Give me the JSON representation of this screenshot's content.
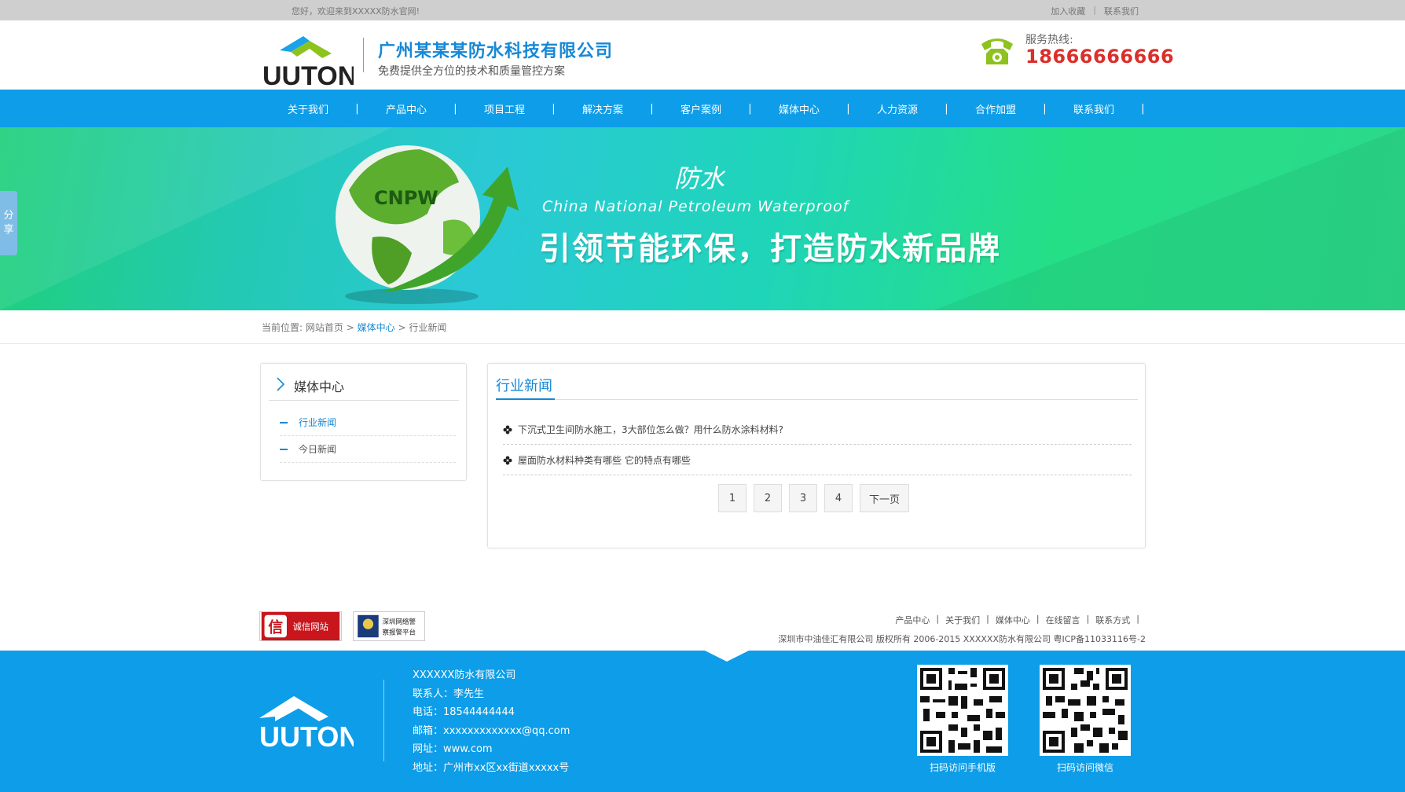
{
  "topbar": {
    "welcome": "您好，欢迎来到XXXXX防水官网!",
    "links": [
      "加入收藏",
      "联系我们"
    ]
  },
  "header": {
    "company_name": "广州某某某防水科技有限公司",
    "slogan": "免费提供全方位的技术和质量管控方案",
    "logo_text": "UUTON",
    "hotline_label": "服务热线:",
    "hotline_number": "18666666666"
  },
  "nav": {
    "items": [
      "关于我们",
      "产品中心",
      "项目工程",
      "解决方案",
      "客户案例",
      "媒体中心",
      "人力资源",
      "合作加盟",
      "联系我们"
    ],
    "separator": "|"
  },
  "banner": {
    "globe_text": "CNPW",
    "title": "防水",
    "subtitle_en": "China  National  Petroleum  Waterproof",
    "slogan": "引领节能环保，打造防水新品牌"
  },
  "share_tab": {
    "label_line1": "分",
    "label_line2": "享"
  },
  "breadcrumb": {
    "prefix": "当前位置:",
    "home": "网站首页",
    "sep": ">",
    "section": "媒体中心",
    "current": "行业新闻"
  },
  "sidebar": {
    "title": "媒体中心",
    "items": [
      {
        "label": "行业新闻",
        "active": true
      },
      {
        "label": "今日新闻",
        "active": false
      }
    ]
  },
  "main": {
    "title": "行业新闻",
    "news": [
      "下沉式卫生间防水施工，3大部位怎么做？用什么防水涂料材料?",
      "屋面防水材料种类有哪些 它的特点有哪些"
    ],
    "pager": {
      "pages": [
        "1",
        "2",
        "3",
        "4"
      ],
      "next": "下一页"
    }
  },
  "footer": {
    "badges": {
      "credit": "诚信网站",
      "credit_icon": "信",
      "police_line1": "深圳网络警",
      "police_line2": "察报警平台"
    },
    "links": [
      "产品中心",
      "关于我们",
      "媒体中心",
      "在线留言",
      "联系方式"
    ],
    "link_sep": "|",
    "copyright": "深圳市中油佳汇有限公司 版权所有 2006-2015 XXXXXX防水有限公司 粤ICP备11033116号-2",
    "company": "XXXXXX防水有限公司",
    "contact": "联系人：李先生",
    "phone": "电话：18544444444",
    "email": "邮箱：xxxxxxxxxxxxx@qq.com",
    "website": "网址：www.com",
    "address": "地址：广州市xx区xx街道xxxxx号",
    "qr_mobile_label": "扫码访问手机版",
    "qr_wechat_label": "扫码访问微信"
  },
  "colors": {
    "brand_blue": "#0e9de8",
    "link_blue": "#1688d6",
    "hotline_red": "#d9302c",
    "logo_green": "#8dc21f",
    "banner_green": "#25df86"
  }
}
